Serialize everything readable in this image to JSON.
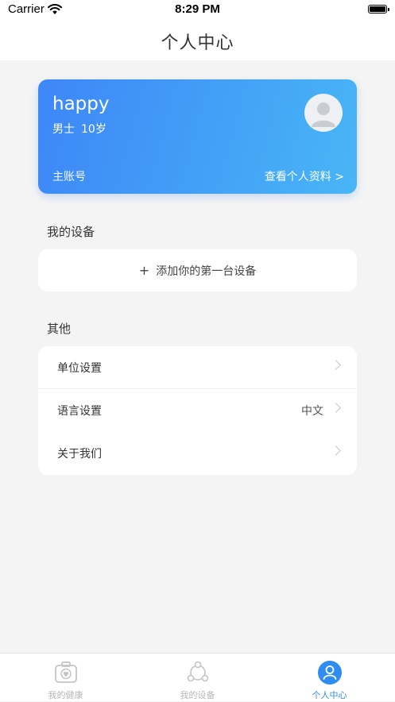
{
  "status_bar": {
    "carrier": "Carrier",
    "time": "8:29 PM"
  },
  "nav": {
    "title": "个人中心"
  },
  "profile": {
    "name": "happy",
    "gender": "男士",
    "age": "10岁",
    "account_type": "主账号",
    "view_profile": "查看个人资料 >"
  },
  "devices": {
    "section_title": "我的设备",
    "add_plus": "+",
    "add_label": "添加你的第一台设备"
  },
  "others": {
    "section_title": "其他",
    "items": [
      {
        "label": "单位设置",
        "value": ""
      },
      {
        "label": "语言设置",
        "value": "中文"
      },
      {
        "label": "关于我们",
        "value": ""
      }
    ]
  },
  "tabbar": {
    "tabs": [
      {
        "label": "我的健康",
        "icon": "health-kit-icon"
      },
      {
        "label": "我的设备",
        "icon": "device-network-icon"
      },
      {
        "label": "个人中心",
        "icon": "person-icon"
      }
    ],
    "active_color": "#2f8cf0"
  },
  "colors": {
    "card_gradient_start": "#3d86f7",
    "card_gradient_end": "#48b6f6"
  }
}
